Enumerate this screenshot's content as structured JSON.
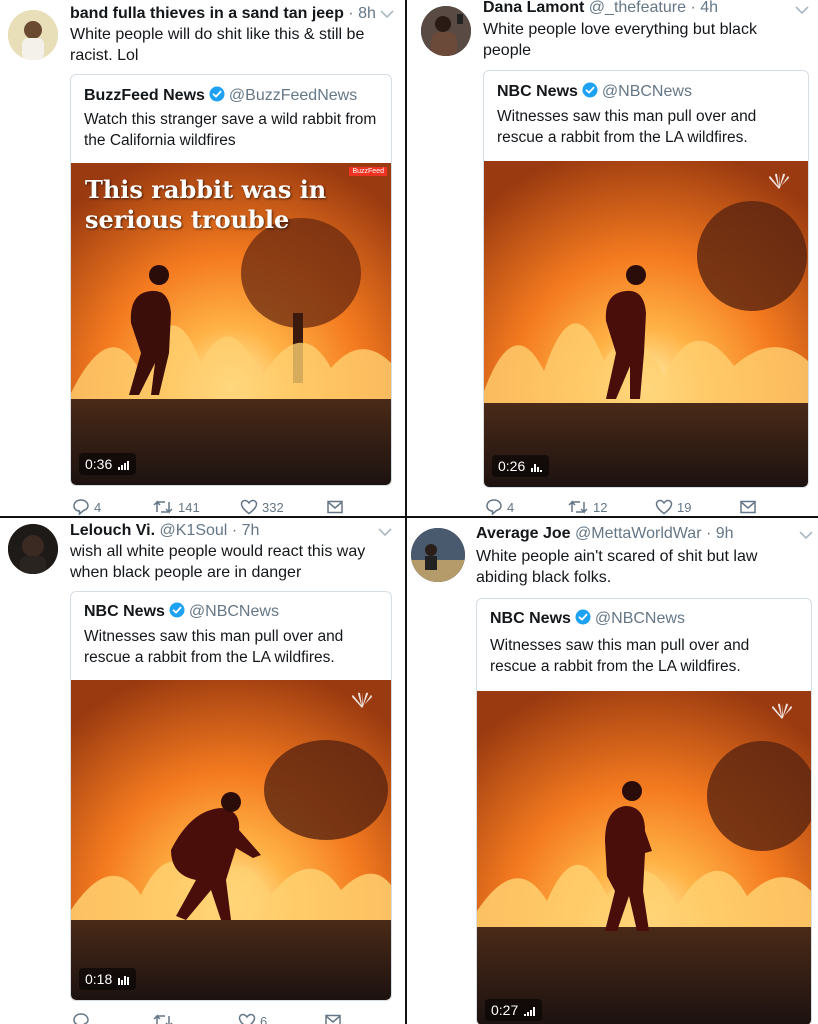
{
  "tweets": [
    {
      "name": "band fulla thieves in a sand tan jeep",
      "handle": "",
      "time": "· 8h",
      "text": "White people will do shit like this & still be racist. Lol",
      "quote": {
        "name": "BuzzFeed News",
        "handle": "@BuzzFeedNews",
        "text": "Watch this stranger save a wild rabbit from the California wildfires",
        "overlay": "This rabbit was in serious trouble",
        "duration": "0:36"
      },
      "actions": {
        "replies": "4",
        "retweets": "141",
        "likes": "332"
      }
    },
    {
      "name": "Dana Lamont",
      "handle": "@_thefeature",
      "time": "· 4h",
      "text": "White people love everything but black people",
      "quote": {
        "name": "NBC News",
        "handle": "@NBCNews",
        "text": "Witnesses saw this man pull over and rescue a rabbit from the LA wildfires.",
        "duration": "0:26"
      },
      "actions": {
        "replies": "4",
        "retweets": "12",
        "likes": "19"
      }
    },
    {
      "name": "Lelouch Vi.",
      "handle": "@K1Soul",
      "time": "· 7h",
      "text": "wish all white people would react this way when black people are in danger",
      "quote": {
        "name": "NBC News",
        "handle": "@NBCNews",
        "text": "Witnesses saw this man pull over and rescue a rabbit from the LA wildfires.",
        "duration": "0:18"
      },
      "actions": {
        "replies": "",
        "retweets": "",
        "likes": "6"
      }
    },
    {
      "name": "Average Joe",
      "handle": "@MettaWorldWar",
      "time": "· 9h",
      "text": "White people ain't scared of shit but law abiding black folks.",
      "quote": {
        "name": "NBC News",
        "handle": "@NBCNews",
        "text": "Witnesses saw this man pull over and rescue a rabbit from the LA wildfires.",
        "duration": "0:27"
      }
    }
  ],
  "colors": {
    "text": "#14171a",
    "secondary": "#657786",
    "verified": "#1da1f2",
    "fire": "#ff7a1a"
  },
  "icons": [
    "reply-icon",
    "retweet-icon",
    "like-icon",
    "dm-icon",
    "verified-icon",
    "chevron-down-icon",
    "nbc-peacock-icon"
  ]
}
